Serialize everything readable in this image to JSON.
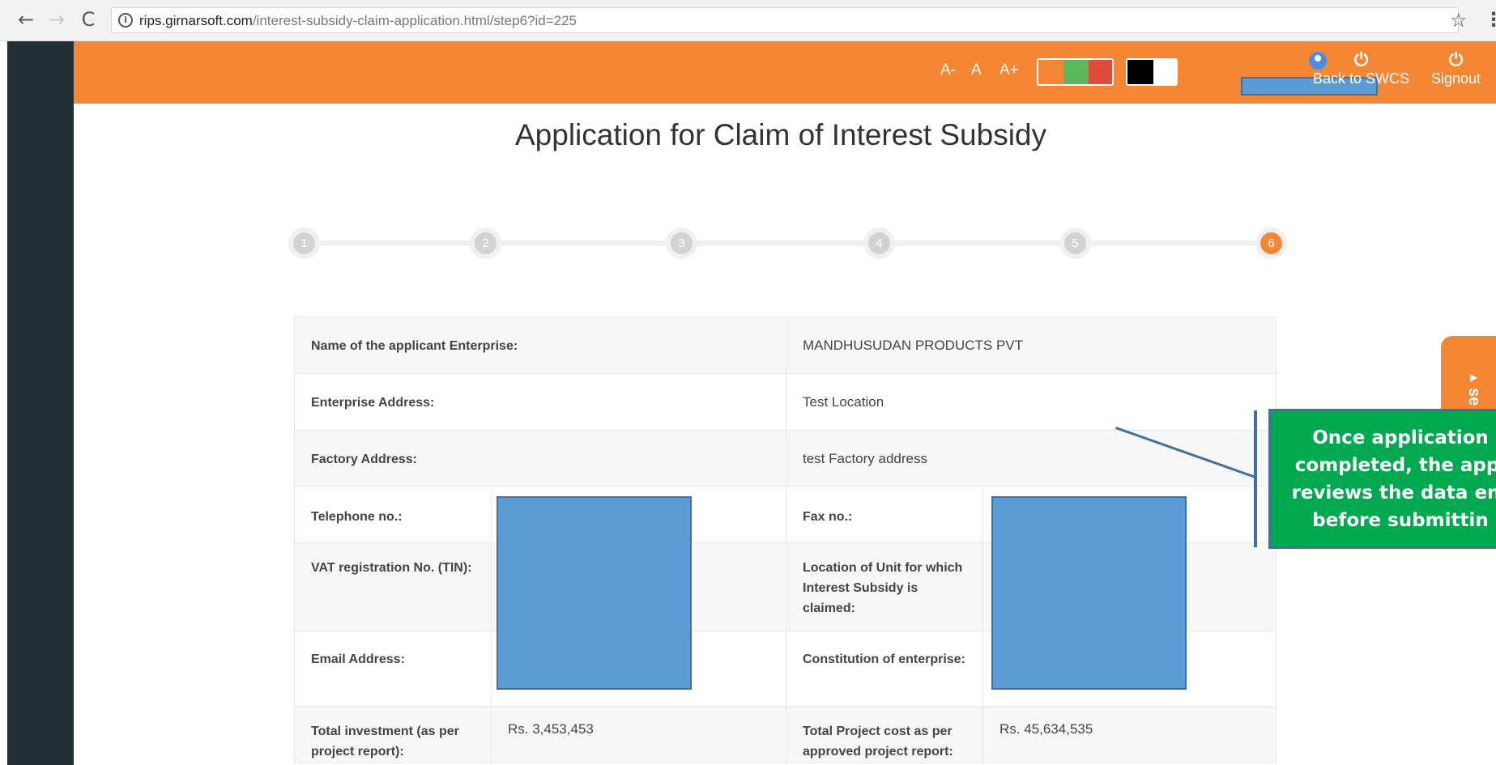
{
  "browser": {
    "back_icon": "back-arrow-icon",
    "forward_icon": "forward-arrow-icon",
    "reload_icon": "reload-icon",
    "url_host": "rips.girnarsoft.com",
    "url_path": "/interest-subsidy-claim-application.html/step6?id=225"
  },
  "header": {
    "font_decrease": "A-",
    "font_normal": "A",
    "font_increase": "A+",
    "theme_colors": [
      "#f58634",
      "#5cb85c",
      "#e04b3a"
    ],
    "contrast_colors": [
      "#000000",
      "#ffffff"
    ],
    "back_label": "Back to SWCS",
    "signout_label": "Signout"
  },
  "page": {
    "title": "Application for Claim of Interest Subsidy"
  },
  "stepper": {
    "steps": [
      "1",
      "2",
      "3",
      "4",
      "5",
      "6"
    ],
    "active_step": "6"
  },
  "table": {
    "applicant_label": "Name of the applicant Enterprise:",
    "applicant_value": "MANDHUSUDAN PRODUCTS PVT",
    "enterprise_address_label": "Enterprise Address:",
    "enterprise_address_value": "Test Location",
    "factory_address_label": "Factory Address:",
    "factory_address_value": "test Factory address",
    "telephone_label": "Telephone no.:",
    "fax_label": "Fax no.:",
    "vat_label": "VAT registration No. (TIN):",
    "location_label": "Location of Unit for which Interest Subsidy is claimed:",
    "email_label": "Email Address:",
    "constitution_label": "Constitution of enterprise:",
    "total_investment_label": "Total investment (as per project report):",
    "total_investment_value": "Rs. 3,453,453",
    "project_cost_label": "Total Project cost as per approved project report:",
    "project_cost_value": "Rs. 45,634,535"
  },
  "callout": {
    "line1": "Once application",
    "line2": "completed, the appl",
    "line3": "reviews the data ent",
    "line4": "before submittin"
  },
  "side_tab": {
    "label": "se"
  }
}
